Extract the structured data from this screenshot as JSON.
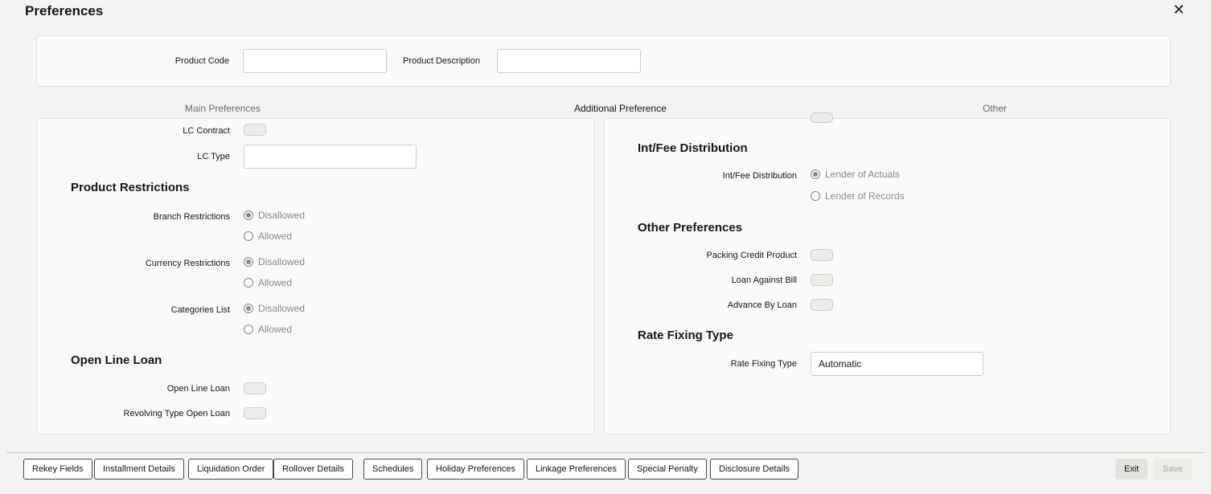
{
  "window": {
    "title": "Preferences",
    "close_icon": "close-icon"
  },
  "header": {
    "product_code_label": "Product Code",
    "product_code_value": "",
    "product_description_label": "Product Description",
    "product_description_value": ""
  },
  "tabs": [
    {
      "label": "Main Preferences",
      "active": false
    },
    {
      "label": "Additional Preference",
      "active": true
    },
    {
      "label": "Other",
      "active": false
    }
  ],
  "left": {
    "lc_contract_label": "LC Contract",
    "lc_type_label": "LC Type",
    "lc_type_value": "",
    "product_restrictions_heading": "Product Restrictions",
    "branch_restrictions_label": "Branch Restrictions",
    "currency_restrictions_label": "Currency Restrictions",
    "categories_list_label": "Categories List",
    "option_disallowed": "Disallowed",
    "option_allowed": "Allowed",
    "open_line_loan_heading": "Open Line Loan",
    "open_line_loan_label": "Open Line Loan",
    "revolving_type_label": "Revolving Type Open Loan"
  },
  "right": {
    "int_fee_heading": "Int/Fee Distribution",
    "int_fee_label": "Int/Fee Distribution",
    "option_lender_actuals": "Lender of Actuals",
    "option_lender_records": "Lender of Records",
    "other_prefs_heading": "Other Preferences",
    "packing_credit_label": "Packing Credit Product",
    "loan_against_bill_label": "Loan Against Bill",
    "advance_by_loan_label": "Advance By Loan",
    "rate_fixing_heading": "Rate Fixing Type",
    "rate_fixing_label": "Rate Fixing Type",
    "rate_fixing_value": "Automatic"
  },
  "footer": {
    "buttons": [
      "Rekey Fields",
      "Installment Details",
      "Liquidation Order",
      "Rollover Details",
      "Schedules",
      "Holiday Preferences",
      "Linkage Preferences",
      "Special Penalty",
      "Disclosure Details"
    ],
    "exit": "Exit",
    "save": "Save"
  }
}
